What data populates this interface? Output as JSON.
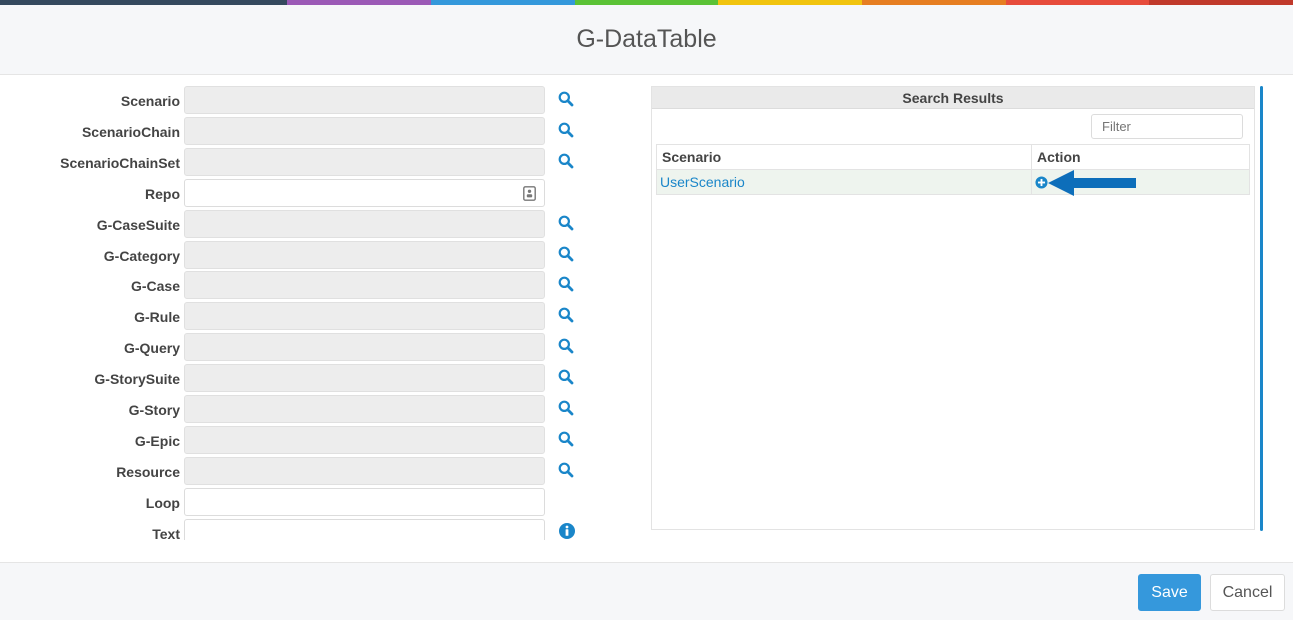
{
  "top_bar_colors": [
    "#35495e",
    "#35495e",
    "#9b59b6",
    "#3498db",
    "#5bc236",
    "#f1c40f",
    "#e67e22",
    "#e74c3c",
    "#c0392b"
  ],
  "dialog": {
    "title": "G-DataTable"
  },
  "form": {
    "fields": [
      {
        "label": "Scenario",
        "kind": "readonly",
        "side_icon": "search-icon"
      },
      {
        "label": "ScenarioChain",
        "kind": "readonly",
        "side_icon": "search-icon"
      },
      {
        "label": "ScenarioChainSet",
        "kind": "readonly",
        "side_icon": "search-icon"
      },
      {
        "label": "Repo",
        "kind": "picker",
        "side_icon": ""
      },
      {
        "label": "G-CaseSuite",
        "kind": "readonly",
        "side_icon": "search-icon"
      },
      {
        "label": "G-Category",
        "kind": "readonly",
        "side_icon": "search-icon"
      },
      {
        "label": "G-Case",
        "kind": "readonly",
        "side_icon": "search-icon"
      },
      {
        "label": "G-Rule",
        "kind": "readonly",
        "side_icon": "search-icon"
      },
      {
        "label": "G-Query",
        "kind": "readonly",
        "side_icon": "search-icon"
      },
      {
        "label": "G-StorySuite",
        "kind": "readonly",
        "side_icon": "search-icon"
      },
      {
        "label": "G-Story",
        "kind": "readonly",
        "side_icon": "search-icon"
      },
      {
        "label": "G-Epic",
        "kind": "readonly",
        "side_icon": "search-icon"
      },
      {
        "label": "Resource",
        "kind": "readonly",
        "side_icon": "search-icon"
      },
      {
        "label": "Loop",
        "kind": "text",
        "side_icon": ""
      },
      {
        "label": "Text",
        "kind": "text",
        "side_icon": "info-icon"
      }
    ]
  },
  "results": {
    "title": "Search Results",
    "filter_placeholder": "Filter",
    "columns": [
      "Scenario",
      "Action"
    ],
    "rows": [
      {
        "scenario": "UserScenario",
        "action_icon": "add-circle-icon"
      }
    ],
    "annotation": "arrow-pointing-left"
  },
  "footer": {
    "save_label": "Save",
    "cancel_label": "Cancel"
  },
  "colors": {
    "accent": "#1a86c9",
    "save_button": "#3598dc"
  }
}
